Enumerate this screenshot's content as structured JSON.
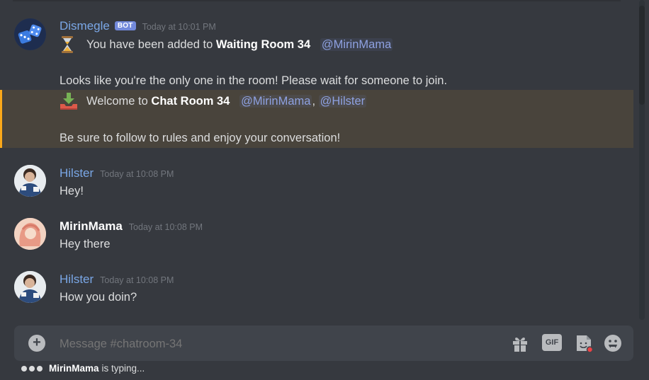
{
  "channel": {
    "composer_placeholder": "Message #chatroom-34",
    "typing_user": "MirinMama",
    "typing_suffix": "is typing..."
  },
  "messages": [
    {
      "author": "Dismegle",
      "tag": "BOT",
      "timestamp": "Today at 10:01 PM",
      "lines": [
        {
          "prefix": "You have been added to ",
          "bold": "Waiting Room 34",
          "mention": "@MirinMama"
        },
        {
          "text": "Looks like you're the only one in the room! Please wait for someone to join."
        }
      ],
      "avatar_icon": "dice-icon",
      "line_icon": "hourglass-icon"
    },
    {
      "highlighted": true,
      "lines": [
        {
          "prefix": "Welcome to ",
          "bold": "Chat Room 34",
          "mention1": "@MirinMama",
          "sep": ",",
          "mention2": "@Hilster"
        },
        {
          "text": "Be sure to follow to rules and enjoy your conversation!"
        }
      ],
      "line_icon": "inbox-download-icon"
    },
    {
      "author": "Hilster",
      "timestamp": "Today at 10:08 PM",
      "text": "Hey!"
    },
    {
      "author": "MirinMama",
      "timestamp": "Today at 10:08 PM",
      "text": "Hey there"
    },
    {
      "author": "Hilster",
      "timestamp": "Today at 10:08 PM",
      "text": "How you doin?"
    }
  ],
  "composer_icons": [
    "plus-icon",
    "gift-icon",
    "gif-icon",
    "sticker-icon",
    "emoji-icon"
  ],
  "composer_gif_label": "GIF",
  "colors": {
    "background": "#36393f",
    "bot_tag": "#7289da",
    "mention": "#8ea1e1",
    "highlight_bar": "#faa81a",
    "highlight_bg": "#49443c",
    "composer_bg": "#40444b"
  }
}
